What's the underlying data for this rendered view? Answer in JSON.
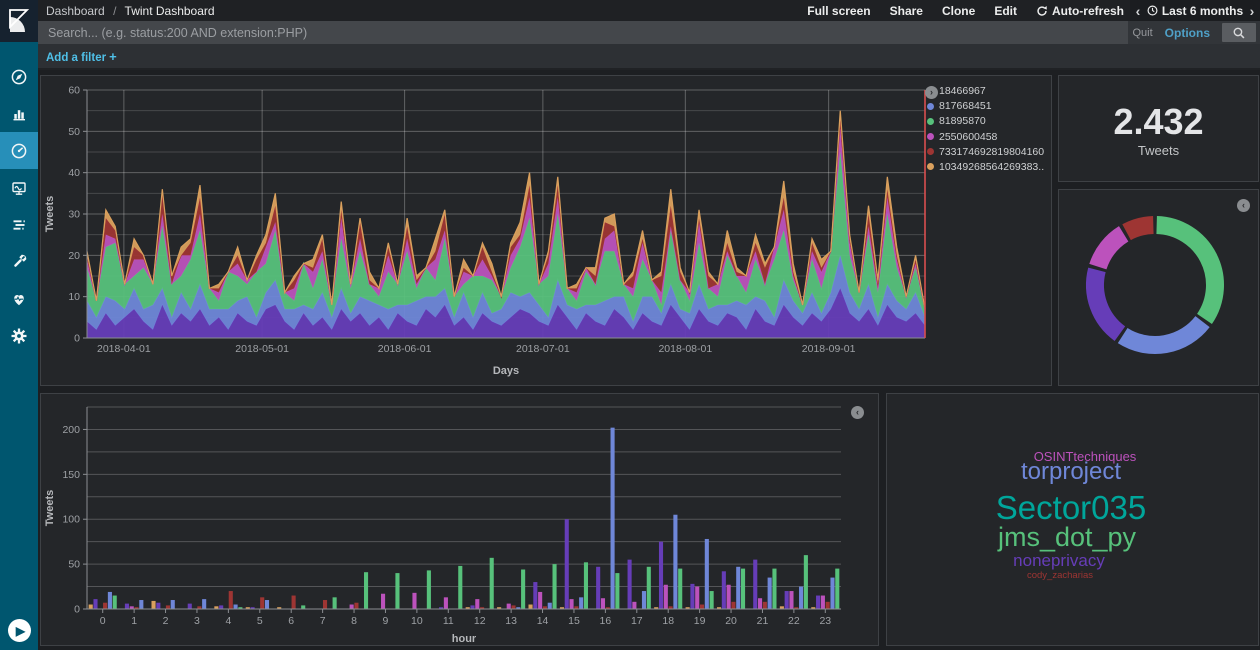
{
  "app": {
    "breadcrumb": {
      "section": "Dashboard",
      "separator": "/",
      "title": "Twint Dashboard"
    },
    "menu": {
      "full_screen": "Full screen",
      "share": "Share",
      "clone": "Clone",
      "edit": "Edit",
      "auto_refresh": "Auto-refresh"
    },
    "timepicker": {
      "prev": "‹",
      "label": "Last 6 months",
      "next": "›"
    }
  },
  "search": {
    "placeholder": "Search... (e.g. status:200 AND extension:PHP)",
    "quit_label": "Quit",
    "options_label": "Options"
  },
  "filter_bar": {
    "add_filter_label": "Add a filter",
    "plus": "+"
  },
  "sidebar": {
    "items": [
      "discover",
      "visualize",
      "dashboard",
      "timelion",
      "logs",
      "dev-tools",
      "monitoring",
      "management"
    ],
    "active": "dashboard"
  },
  "panels": {
    "metric": {
      "value": "2.432",
      "label": "Tweets"
    }
  },
  "chart_data": [
    {
      "type": "area",
      "stacked": true,
      "xlabel": "Days",
      "ylabel": "Tweets",
      "ylim": [
        0,
        60
      ],
      "y_tick_step": 10,
      "y_grid_step": 5,
      "x_range": [
        "2018-03-24",
        "2018-09-22"
      ],
      "x_ticks": [
        {
          "label": "2018-04-01",
          "frac": 0.044
        },
        {
          "label": "2018-05-01",
          "frac": 0.209
        },
        {
          "label": "2018-06-01",
          "frac": 0.379
        },
        {
          "label": "2018-07-01",
          "frac": 0.544
        },
        {
          "label": "2018-08-01",
          "frac": 0.714
        },
        {
          "label": "2018-09-01",
          "frac": 0.885
        }
      ],
      "legend_position": "right",
      "grid": true,
      "end_marker_color": "#d94f4f",
      "series": [
        {
          "name": "18466967",
          "color": "#663db8",
          "values": [
            4,
            2,
            6,
            3,
            5,
            7,
            4,
            2,
            8,
            3,
            6,
            4,
            7,
            3,
            5,
            2,
            6,
            4,
            3,
            7,
            8,
            4,
            2,
            6,
            3,
            5,
            2,
            7,
            4,
            6,
            3,
            5,
            2,
            6,
            4,
            3,
            7,
            5,
            8,
            3,
            5,
            2,
            6,
            4,
            3,
            5,
            7,
            6,
            4,
            3,
            8,
            5,
            2,
            6,
            4,
            3,
            7,
            5,
            2,
            6,
            4,
            3,
            8,
            5,
            2,
            7,
            4,
            3,
            6,
            5,
            2,
            7,
            4,
            3,
            8,
            5,
            3,
            6,
            4,
            7,
            12,
            6,
            4,
            7,
            3,
            8,
            5,
            4,
            6,
            3
          ]
        },
        {
          "name": "817668451",
          "color": "#6f87d8",
          "values": [
            5,
            3,
            4,
            6,
            2,
            5,
            3,
            6,
            4,
            2,
            5,
            3,
            6,
            4,
            2,
            5,
            3,
            6,
            2,
            4,
            6,
            3,
            5,
            2,
            4,
            6,
            3,
            5,
            2,
            4,
            6,
            3,
            5,
            2,
            4,
            6,
            3,
            5,
            4,
            2,
            6,
            3,
            5,
            2,
            4,
            6,
            3,
            5,
            4,
            2,
            6,
            3,
            5,
            2,
            4,
            6,
            3,
            5,
            2,
            4,
            6,
            3,
            5,
            2,
            4,
            6,
            3,
            5,
            2,
            4,
            6,
            3,
            5,
            2,
            6,
            4,
            3,
            5,
            2,
            4,
            8,
            5,
            3,
            6,
            2,
            5,
            4,
            3,
            5,
            2
          ]
        },
        {
          "name": "81895870",
          "color": "#57c17b",
          "values": [
            8,
            4,
            12,
            14,
            6,
            3,
            10,
            5,
            15,
            8,
            4,
            12,
            13,
            5,
            2,
            9,
            6,
            3,
            11,
            7,
            12,
            4,
            2,
            10,
            5,
            8,
            3,
            12,
            6,
            11,
            4,
            2,
            9,
            5,
            13,
            3,
            7,
            4,
            12,
            5,
            2,
            10,
            4,
            8,
            3,
            6,
            12,
            18,
            5,
            10,
            16,
            4,
            2,
            8,
            5,
            12,
            11,
            3,
            6,
            9,
            4,
            2,
            13,
            7,
            3,
            10,
            5,
            2,
            12,
            6,
            3,
            9,
            4,
            14,
            12,
            5,
            2,
            8,
            6,
            10,
            25,
            9,
            4,
            12,
            6,
            17,
            8,
            3,
            6,
            2
          ]
        },
        {
          "name": "2550600458",
          "color": "#bc52bc",
          "values": [
            2,
            0,
            3,
            1,
            0,
            4,
            2,
            0,
            3,
            0,
            5,
            1,
            4,
            0,
            2,
            0,
            3,
            1,
            0,
            4,
            2,
            0,
            3,
            0,
            4,
            2,
            0,
            5,
            1,
            3,
            0,
            2,
            4,
            0,
            3,
            1,
            0,
            5,
            2,
            0,
            3,
            0,
            4,
            1,
            0,
            3,
            2,
            5,
            0,
            3,
            4,
            0,
            2,
            1,
            0,
            3,
            5,
            0,
            2,
            4,
            0,
            3,
            1,
            0,
            2,
            5,
            0,
            3,
            1,
            0,
            4,
            2,
            0,
            3,
            5,
            1,
            0,
            2,
            4,
            0,
            6,
            3,
            0,
            2,
            1,
            4,
            2,
            0,
            1,
            0
          ]
        },
        {
          "name": "733174692819804160",
          "color": "#9e3533",
          "values": [
            1,
            0,
            4,
            2,
            0,
            3,
            1,
            0,
            5,
            2,
            0,
            3,
            4,
            0,
            1,
            0,
            2,
            0,
            3,
            1,
            4,
            0,
            2,
            0,
            1,
            3,
            0,
            2,
            0,
            4,
            1,
            0,
            2,
            0,
            3,
            1,
            0,
            2,
            4,
            0,
            1,
            0,
            3,
            1,
            0,
            2,
            1,
            3,
            0,
            2,
            3,
            0,
            1,
            0,
            2,
            4,
            1,
            0,
            3,
            1,
            0,
            4,
            5,
            2,
            0,
            1,
            3,
            0,
            2,
            1,
            0,
            2,
            4,
            0,
            3,
            1,
            0,
            2,
            1,
            0,
            2,
            1,
            0,
            3,
            1,
            2,
            1,
            0,
            1,
            0
          ]
        },
        {
          "name": "10349268564269383...",
          "color": "#daa05d",
          "values": [
            1,
            0,
            2,
            1,
            0,
            2,
            0,
            0,
            1,
            0,
            2,
            1,
            3,
            0,
            1,
            0,
            2,
            0,
            1,
            2,
            3,
            0,
            1,
            0,
            2,
            1,
            0,
            2,
            0,
            1,
            2,
            0,
            1,
            0,
            2,
            1,
            0,
            3,
            1,
            0,
            2,
            0,
            1,
            2,
            0,
            1,
            3,
            3,
            0,
            1,
            2,
            0,
            1,
            0,
            2,
            1,
            3,
            0,
            1,
            2,
            0,
            1,
            4,
            1,
            0,
            2,
            1,
            0,
            3,
            1,
            0,
            2,
            1,
            0,
            4,
            2,
            0,
            1,
            2,
            0,
            2,
            1,
            0,
            2,
            1,
            3,
            2,
            0,
            1,
            0
          ]
        }
      ]
    },
    {
      "type": "bar",
      "grouped": true,
      "xlabel": "hour",
      "ylabel": "Tweets",
      "ylim": [
        0,
        225
      ],
      "y_ticks": [
        0,
        50,
        100,
        150,
        200
      ],
      "y_grid_step": 25,
      "grid": true,
      "categories": [
        "0",
        "1",
        "2",
        "3",
        "4",
        "5",
        "6",
        "7",
        "8",
        "9",
        "10",
        "11",
        "12",
        "13",
        "14",
        "15",
        "16",
        "17",
        "18",
        "19",
        "20",
        "21",
        "22",
        "23"
      ],
      "series": [
        {
          "name": "10349268564269383...",
          "color": "#daa05d",
          "values": [
            5,
            0,
            9,
            0,
            3,
            2,
            2,
            0,
            0,
            0,
            0,
            0,
            2,
            2,
            5,
            2,
            0,
            0,
            2,
            2,
            2,
            0,
            3,
            2
          ]
        },
        {
          "name": "18466967",
          "color": "#663db8",
          "values": [
            11,
            6,
            7,
            6,
            4,
            2,
            0,
            0,
            0,
            0,
            0,
            2,
            4,
            0,
            30,
            100,
            47,
            55,
            75,
            28,
            42,
            55,
            20,
            15
          ]
        },
        {
          "name": "2550600458",
          "color": "#bc52bc",
          "values": [
            0,
            3,
            0,
            0,
            0,
            0,
            0,
            0,
            5,
            17,
            18,
            13,
            11,
            6,
            19,
            11,
            12,
            8,
            27,
            25,
            27,
            12,
            20,
            15
          ]
        },
        {
          "name": "733174692819804160",
          "color": "#9e3533",
          "values": [
            7,
            2,
            4,
            3,
            20,
            13,
            15,
            10,
            7,
            0,
            0,
            0,
            2,
            4,
            3,
            3,
            2,
            0,
            3,
            5,
            8,
            8,
            2,
            8
          ]
        },
        {
          "name": "817668451",
          "color": "#6f87d8",
          "values": [
            19,
            10,
            10,
            11,
            5,
            10,
            0,
            0,
            0,
            0,
            0,
            0,
            0,
            2,
            7,
            13,
            202,
            20,
            105,
            78,
            47,
            35,
            25,
            35
          ]
        },
        {
          "name": "81895870",
          "color": "#57c17b",
          "values": [
            15,
            0,
            0,
            0,
            2,
            0,
            4,
            13,
            41,
            40,
            43,
            48,
            57,
            44,
            50,
            52,
            40,
            47,
            45,
            20,
            45,
            45,
            60,
            45
          ]
        }
      ]
    },
    {
      "type": "pie",
      "donut": true,
      "legend": "collapsed",
      "slices": [
        {
          "color": "#57c17b",
          "pct": 35.0
        },
        {
          "color": "#6f87d8",
          "pct": 24.5
        },
        {
          "color": "#663db8",
          "pct": 20.0
        },
        {
          "color": "#bc52bc",
          "pct": 12.2
        },
        {
          "color": "#9e3533",
          "pct": 8.3
        }
      ]
    },
    {
      "type": "tagcloud",
      "tags": [
        {
          "text": "OSINTtechniques",
          "color": "#bc52bc",
          "size": 13,
          "x": 198,
          "y": 56
        },
        {
          "text": "torproject",
          "color": "#6f87d8",
          "size": 24,
          "x": 184,
          "y": 66
        },
        {
          "text": "Sector035",
          "color": "#00a69b",
          "size": 33,
          "x": 184,
          "y": 97
        },
        {
          "text": "jms_dot_py",
          "color": "#57c17b",
          "size": 27,
          "x": 180,
          "y": 130
        },
        {
          "text": "noneprivacy",
          "color": "#663db8",
          "size": 17,
          "x": 172,
          "y": 158
        },
        {
          "text": "cody_zacharias",
          "color": "#9e3533",
          "size": 9.5,
          "x": 173,
          "y": 177
        }
      ]
    }
  ]
}
